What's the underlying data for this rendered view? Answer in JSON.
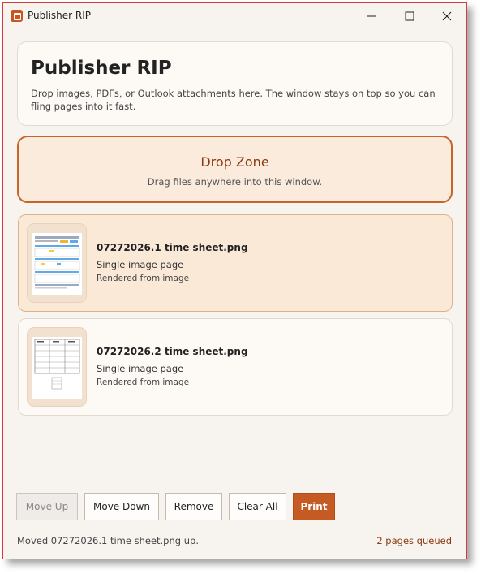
{
  "window": {
    "title": "Publisher RIP"
  },
  "header": {
    "title": "Publisher RIP",
    "description": "Drop images, PDFs, or Outlook attachments here. The window stays on top so you can fling pages into it fast."
  },
  "drop_zone": {
    "title": "Drop Zone",
    "subtitle": "Drag files anywhere into this window."
  },
  "files": [
    {
      "name": "07272026.1 time sheet.png",
      "type": "Single image page",
      "source": "Rendered from image",
      "selected": true
    },
    {
      "name": "07272026.2 time sheet.png",
      "type": "Single image page",
      "source": "Rendered from image",
      "selected": false
    }
  ],
  "toolbar": {
    "move_up": "Move Up",
    "move_down": "Move Down",
    "remove": "Remove",
    "clear_all": "Clear All",
    "print": "Print"
  },
  "status": {
    "message": "Moved 07272026.1 time sheet.png up.",
    "queue": "2 pages queued"
  },
  "colors": {
    "accent": "#c55b23",
    "selected_bg": "#fbe9d8",
    "drop_border": "#c9632c"
  },
  "icons": {
    "app": "publisher-app-icon",
    "minimize": "minimize-icon",
    "maximize": "maximize-icon",
    "close": "close-icon"
  }
}
